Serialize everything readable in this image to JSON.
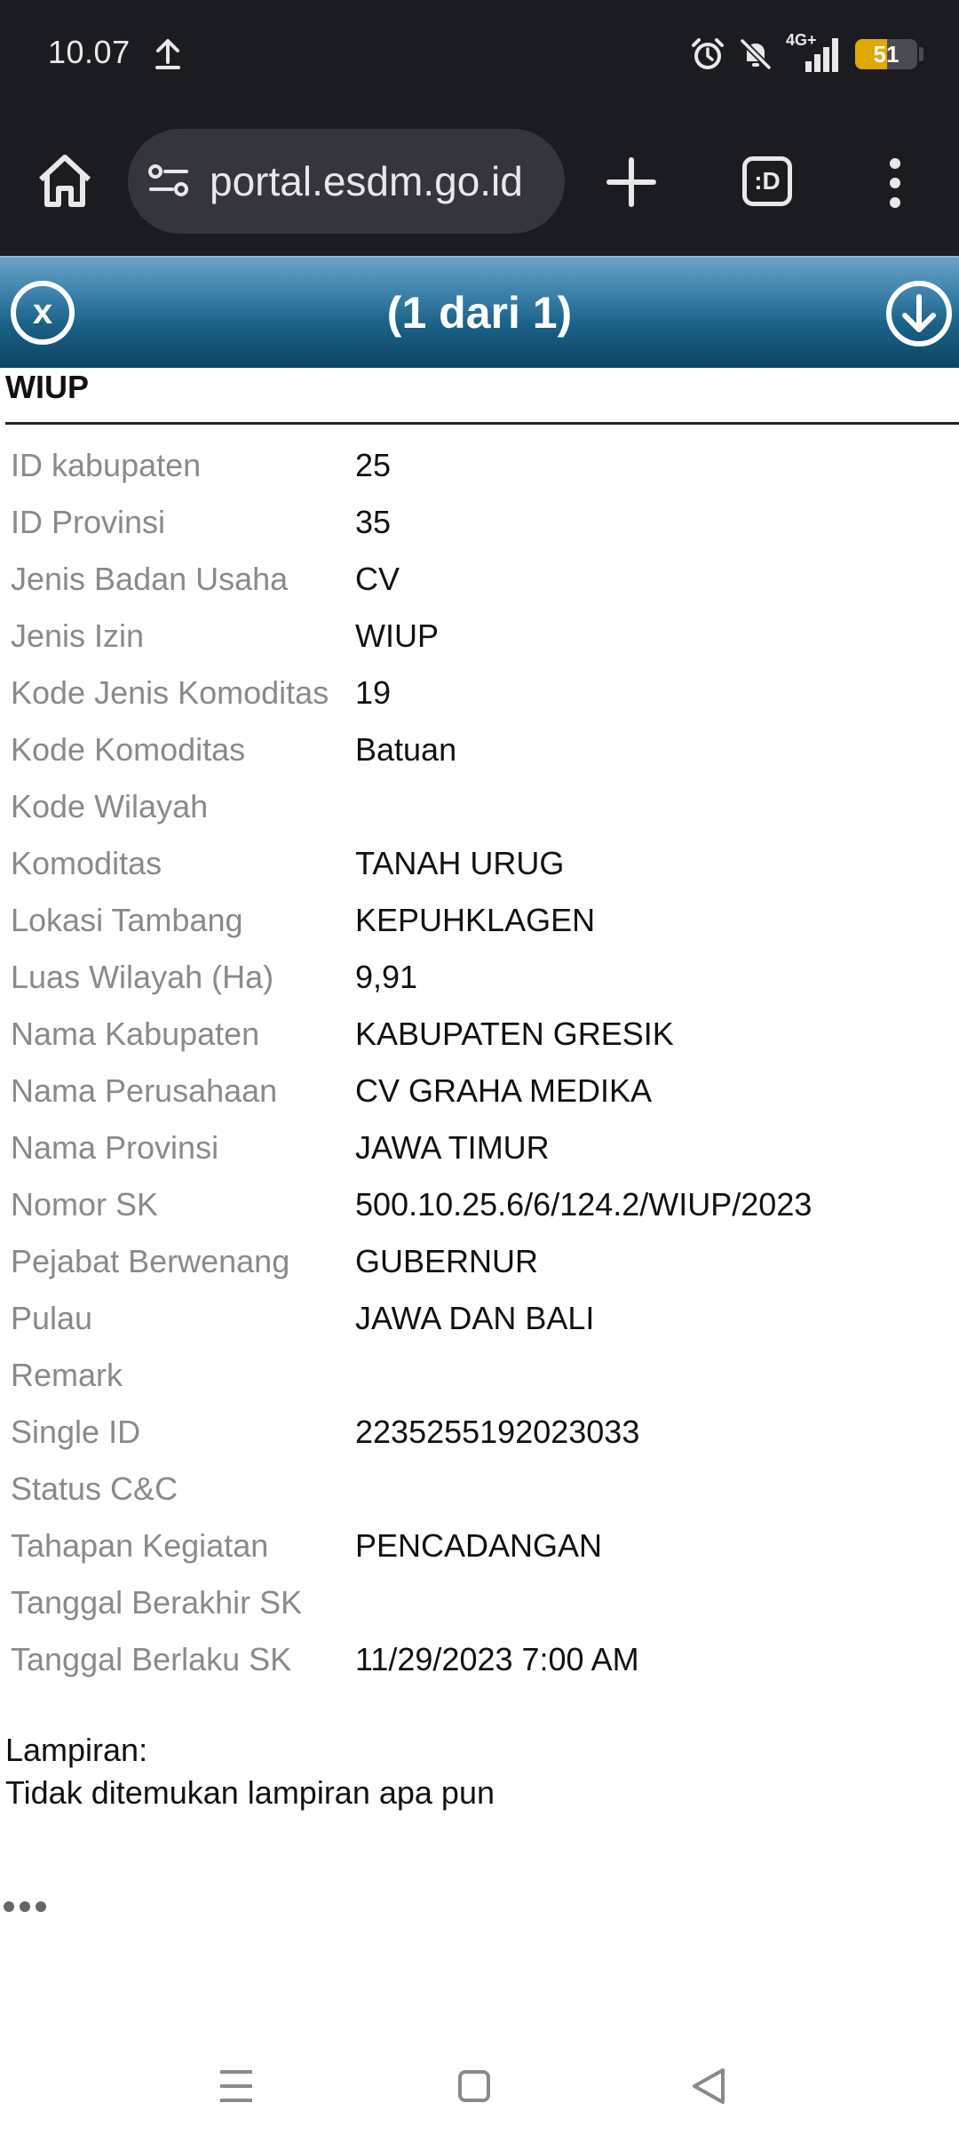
{
  "status_bar": {
    "time": "10.07",
    "network": "4G+",
    "battery": "51",
    "battery_level": 0.51
  },
  "browser": {
    "url": "portal.esdm.go.id",
    "tabs_label": ":D"
  },
  "popup": {
    "title": "(1 dari 1)",
    "close_glyph": "x"
  },
  "layer": {
    "title": "WIUP",
    "rows": [
      {
        "key": "ID kabupaten",
        "value": "25"
      },
      {
        "key": "ID Provinsi",
        "value": "35"
      },
      {
        "key": "Jenis Badan Usaha",
        "value": "CV"
      },
      {
        "key": "Jenis Izin",
        "value": "WIUP"
      },
      {
        "key": "Kode Jenis Komoditas",
        "value": "19"
      },
      {
        "key": "Kode Komoditas",
        "value": "Batuan"
      },
      {
        "key": "Kode Wilayah",
        "value": ""
      },
      {
        "key": "Komoditas",
        "value": "TANAH URUG"
      },
      {
        "key": "Lokasi Tambang",
        "value": "KEPUHKLAGEN"
      },
      {
        "key": "Luas Wilayah (Ha)",
        "value": "9,91"
      },
      {
        "key": "Nama Kabupaten",
        "value": "KABUPATEN GRESIK"
      },
      {
        "key": "Nama Perusahaan",
        "value": "CV GRAHA MEDIKA"
      },
      {
        "key": "Nama Provinsi",
        "value": "JAWA TIMUR"
      },
      {
        "key": "Nomor SK",
        "value": "500.10.25.6/6/124.2/WIUP/2023"
      },
      {
        "key": "Pejabat Berwenang",
        "value": "GUBERNUR"
      },
      {
        "key": "Pulau",
        "value": "JAWA DAN BALI"
      },
      {
        "key": "Remark",
        "value": ""
      },
      {
        "key": "Single ID",
        "value": "2235255192023033"
      },
      {
        "key": "Status C&C",
        "value": ""
      },
      {
        "key": "Tahapan Kegiatan",
        "value": "PENCADANGAN"
      },
      {
        "key": "Tanggal Berakhir SK",
        "value": ""
      },
      {
        "key": "Tanggal Berlaku SK",
        "value": "11/29/2023 7:00 AM"
      }
    ]
  },
  "attachments": {
    "label": "Lampiran:",
    "value": "Tidak ditemukan lampiran apa pun"
  },
  "icons": {
    "upload": "upload-icon",
    "alarm": "alarm-icon",
    "mute": "bell-off-icon",
    "signal": "signal-icon",
    "home": "home-icon",
    "site_info": "site-settings-icon",
    "new_tab": "plus-icon",
    "menu": "more-vert-icon",
    "close": "close-icon",
    "next": "arrow-down-icon"
  }
}
